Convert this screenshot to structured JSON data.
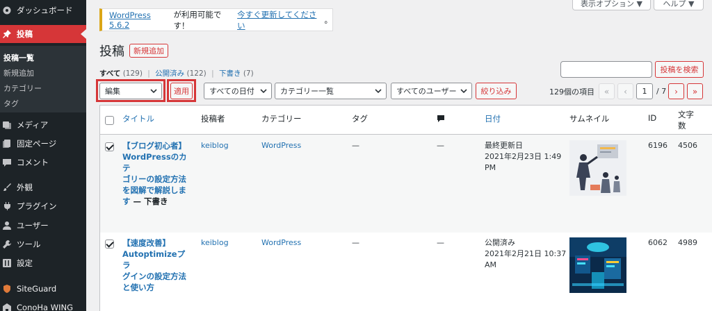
{
  "sidebar": {
    "items": [
      {
        "label": "ダッシュボード",
        "icon": "dashboard-icon"
      },
      {
        "label": "投稿",
        "icon": "pin-icon",
        "active": true
      },
      {
        "label": "メディア",
        "icon": "media-icon"
      },
      {
        "label": "固定ページ",
        "icon": "page-icon"
      },
      {
        "label": "コメント",
        "icon": "comment-icon"
      },
      {
        "label": "外観",
        "icon": "brush-icon"
      },
      {
        "label": "プラグイン",
        "icon": "plugin-icon"
      },
      {
        "label": "ユーザー",
        "icon": "user-icon"
      },
      {
        "label": "ツール",
        "icon": "wrench-icon"
      },
      {
        "label": "設定",
        "icon": "settings-icon"
      },
      {
        "label": "SiteGuard",
        "icon": "siteguard-icon"
      },
      {
        "label": "ConoHa WING",
        "icon": "conoha-icon"
      }
    ],
    "submenu": [
      "投稿一覧",
      "新規追加",
      "カテゴリー",
      "タグ"
    ]
  },
  "screen_meta": {
    "options_label": "表示オプション ▼",
    "help_label": "ヘルプ ▼"
  },
  "notice": {
    "version_link": "WordPress 5.6.2",
    "text": " が利用可能です！",
    "update_link": "今すぐ更新してください",
    "end": "。"
  },
  "page": {
    "title": "投稿",
    "add_new_label": "新規追加"
  },
  "status_links": {
    "all": "すべて",
    "all_count": "(129)",
    "published": "公開済み",
    "published_count": "(122)",
    "draft": "下書き",
    "draft_count": "(7)"
  },
  "search": {
    "button_label": "投稿を検索",
    "value": ""
  },
  "filters": {
    "bulk_action": "編集",
    "apply_label": "適用",
    "date": "すべての日付",
    "category": "カテゴリー一覧",
    "user": "すべてのユーザー",
    "filter_label": "絞り込み"
  },
  "pagination": {
    "items": "129個の項目",
    "current_page": "1",
    "total": "/ 7",
    "first": "«",
    "prev": "‹",
    "next": "›",
    "last": "»"
  },
  "columns": {
    "title": "タイトル",
    "author": "投稿者",
    "category": "カテゴリー",
    "tags": "タグ",
    "date": "日付",
    "thumbnail": "サムネイル",
    "id": "ID",
    "chars_1": "文字",
    "chars_2": "数"
  },
  "rows": [
    {
      "title_lines": [
        "【ブログ初心者】",
        "WordPressのカテ",
        "ゴリーの設定方法",
        "を図解で解説しま"
      ],
      "title_last": "す",
      "state": " — 下書き",
      "author": "keiblog",
      "category": "WordPress",
      "tags": "—",
      "comments": "—",
      "date_status": "最終更新日",
      "date_line1": "2021年2月23日 1:49",
      "date_line2": "PM",
      "id": "6196",
      "chars": "4506",
      "checked": true
    },
    {
      "title_lines": [
        "【速度改善】",
        "Autoptimizeプラ",
        "グインの設定方法",
        "と使い方"
      ],
      "title_last": "",
      "state": "",
      "author": "keiblog",
      "category": "WordPress",
      "tags": "—",
      "comments": "—",
      "date_status": "公開済み",
      "date_line1": "2021年2月21日 10:37",
      "date_line2": "AM",
      "id": "6062",
      "chars": "4989",
      "checked": true
    }
  ]
}
